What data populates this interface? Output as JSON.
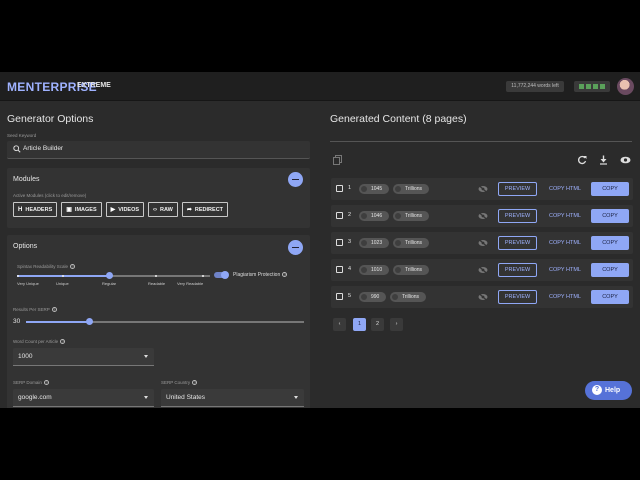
{
  "header": {
    "brand": "MENTERPRISE",
    "brand_sub": "EXTREME",
    "words_left": "11,772,244 words left",
    "status_color": "#5aa05a"
  },
  "left": {
    "title": "Generator Options",
    "seed_label": "Seed Keyword",
    "seed_value": "Article Builder",
    "modules": {
      "title": "Modules",
      "subtitle": "Active Modules (click to edit/remove)",
      "buttons": [
        {
          "label": "HEADERS",
          "icon": "H"
        },
        {
          "label": "IMAGES",
          "icon": "▣"
        },
        {
          "label": "VIDEOS",
          "icon": "▶"
        },
        {
          "label": "RAW",
          "icon": "‹›"
        },
        {
          "label": "REDIRECT",
          "icon": "➦"
        }
      ]
    },
    "options": {
      "title": "Options",
      "readability_label": "Spintax Readability Scale",
      "readability_ticks": [
        "Very Unique",
        "Unique",
        "Regular",
        "Readable",
        "Very Readable"
      ],
      "readability_selected": "Regular",
      "plagiarism_label": "Plagiarism Protection",
      "plagiarism_on": true,
      "results_label": "Results Per SERP",
      "results_value": "30",
      "results_fraction": 0.25,
      "word_count_label": "Word Count per Article",
      "word_count_value": "1000",
      "serp_domain_label": "SERP Domain",
      "serp_domain_value": "google.com",
      "serp_country_label": "SERP Country",
      "serp_country_value": "United States"
    }
  },
  "right": {
    "title": "Generated Content (8 pages)",
    "rows": [
      {
        "num": "1",
        "words": "1045",
        "unit": "Trillions"
      },
      {
        "num": "2",
        "words": "1046",
        "unit": "Trillions"
      },
      {
        "num": "3",
        "words": "1023",
        "unit": "Trillions"
      },
      {
        "num": "4",
        "words": "1010",
        "unit": "Trillions"
      },
      {
        "num": "5",
        "words": "990",
        "unit": "Trillions"
      }
    ],
    "preview_label": "PREVIEW",
    "copy_html_label": "COPY HTML",
    "copy_label": "COPY",
    "pages": [
      "1",
      "2"
    ],
    "current_page": "1"
  },
  "help_label": "Help",
  "accent": "#8fa7f5"
}
